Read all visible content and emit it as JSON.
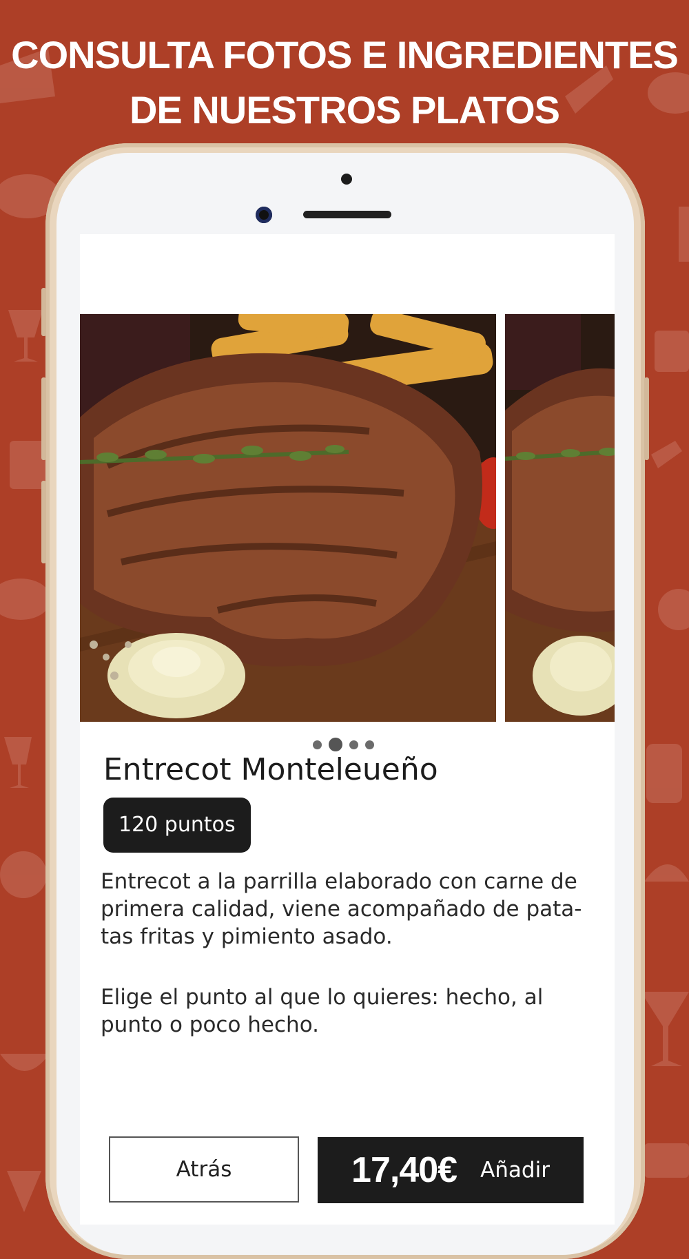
{
  "headline": {
    "line1": "CONSULTA FOTOS E INGREDIENTES",
    "line2": "DE NUESTROS PLATOS"
  },
  "colors": {
    "background": "#ad3f27",
    "button_dark": "#1c1c1c",
    "phone_frame": "#e9d6be"
  },
  "carousel": {
    "photo_count": 4,
    "active_index": 1
  },
  "dish": {
    "title": "Entrecot Monteleueño",
    "points": "120 puntos",
    "description": "Entrecot a la parrilla elaborado con carne de\nprimera calidad, viene acompañado de pata-\ntas fritas y pimiento asado.",
    "note": "Elige el punto al que lo quieres: hecho, al\npunto o poco hecho."
  },
  "actions": {
    "back_label": "Atrás",
    "price": "17,40€",
    "add_label": "Añadir"
  }
}
